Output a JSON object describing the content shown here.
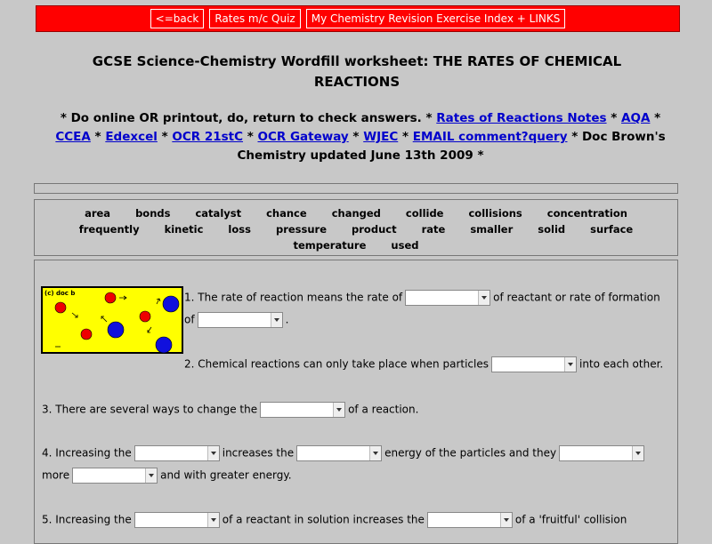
{
  "nav": {
    "back": "<=back",
    "quiz": "Rates m/c Quiz",
    "index": "My Chemistry Revision Exercise Index + LINKS"
  },
  "title": {
    "line1": "GCSE Science-Chemistry Wordfill worksheet: THE RATES OF CHEMICAL",
    "line2": "REACTIONS"
  },
  "subtitle": {
    "t1": "* Do online OR printout, do, return to check answers. * ",
    "l1": "Rates of Reactions Notes",
    "t2": " * ",
    "l2": "AQA",
    "t3": " *",
    "l3": "CCEA",
    "t4": " * ",
    "l4": "Edexcel",
    "t5": " * ",
    "l5": "OCR 21stC",
    "t6": " * ",
    "l6": "OCR Gateway",
    "t7": " * ",
    "l7": "WJEC",
    "t8": " * ",
    "l8": "EMAIL comment?query",
    "t9": " * Doc Brown's",
    "t10": "Chemistry updated June 13th 2009 *"
  },
  "words": [
    "area",
    "bonds",
    "catalyst",
    "chance",
    "changed",
    "collide",
    "collisions",
    "concentration",
    "frequently",
    "kinetic",
    "loss",
    "pressure",
    "product",
    "rate",
    "smaller",
    "solid",
    "surface",
    "temperature",
    "used"
  ],
  "diagram": {
    "label": "(c) doc b"
  },
  "colors": {
    "nav": "#ff0000",
    "link": "#0000cc",
    "diagram_bg": "#ffff00",
    "particle_small": "#ee0000",
    "particle_big": "#1010dd"
  },
  "q1": {
    "a": "1. The rate of reaction means the rate of",
    "b": "of reactant or rate of formation",
    "c": "of",
    "d": "."
  },
  "q2": {
    "a": "2. Chemical reactions can only take place when particles",
    "b": "into each other."
  },
  "q3": {
    "a": "3. There are several ways to change the",
    "b": "of a reaction."
  },
  "q4": {
    "a": "4. Increasing the",
    "b": "increases the",
    "c": "energy of the particles and they",
    "d": "more",
    "e": "and with greater energy."
  },
  "q5": {
    "a": "5. Increasing the",
    "b": "of a reactant in solution increases the",
    "c": "of a 'fruitful' collision"
  }
}
